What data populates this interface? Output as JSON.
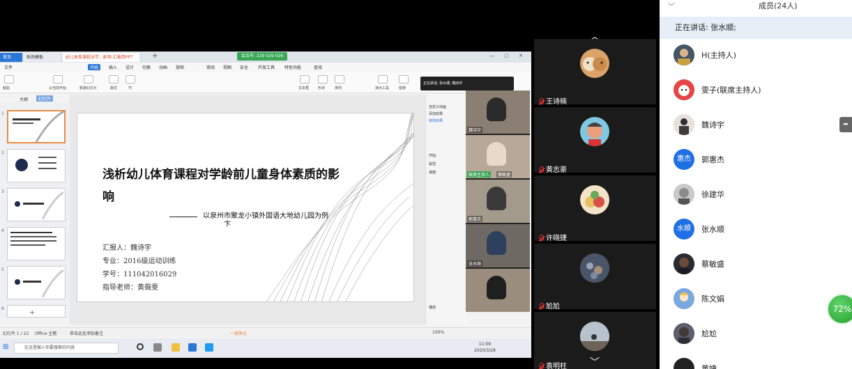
{
  "wps": {
    "tabs": [
      "首页",
      "稻壳模板",
      "幼儿体育课程对学...影响-汇报用PPT"
    ],
    "share_badge": "会议号: 229 529 026",
    "menu": [
      "文件",
      "开始",
      "插入",
      "设计",
      "切换",
      "动画",
      "放映",
      "审阅",
      "视图",
      "安全",
      "开发工具",
      "特色功能",
      "查找"
    ],
    "active_menu": "开始",
    "ribbon_labels": [
      "粘贴",
      "从当前开始",
      "新建幻灯片",
      "版式",
      "节",
      "文本框",
      "形状",
      "排列",
      "演示工具",
      "替换"
    ],
    "panel_tabs": [
      "大纲",
      "幻灯片"
    ],
    "thumb_numbers": [
      "1",
      "2",
      "3",
      "4",
      "5",
      "6"
    ],
    "slide": {
      "title": "浅析幼儿体育课程对学龄前儿童身体素质的影响",
      "dash": "———",
      "subtitle": "以泉州市聚龙小镇外国语大地幼儿园为例",
      "subtitle_tail": "卞",
      "reporter": "汇报人：魏诗宇",
      "major": "专业：2016级运动训练",
      "student_id": "学号：111042016029",
      "advisor": "指导老师：黄薇雯"
    },
    "side_pane": [
      "自定义动画",
      "添加效果",
      "修改效果",
      "开始:",
      "属性:",
      "速度:",
      "播放"
    ],
    "tooltip": "正在讲话: 张水顺; 魏诗宇",
    "video_tiles": [
      {
        "name": "魏诗宇",
        "tag": ""
      },
      {
        "name": "蔡敏盛",
        "tag": "联席主持人"
      },
      {
        "name": "郭惠杰",
        "tag": ""
      },
      {
        "name": "张水顺",
        "tag": ""
      },
      {
        "name": "",
        "tag": ""
      }
    ],
    "status": {
      "slide_count": "幻灯片 1 / 22",
      "theme": "Office 主题",
      "notes": "单击此处添加备注",
      "beautify": "一键美化",
      "zoom": "100%"
    },
    "taskbar": {
      "search_placeholder": "在这里输入你要搜索的内容",
      "time": "11:09",
      "date": "2020/3/28"
    }
  },
  "gallery": {
    "participants": [
      "王诗楠",
      "黄志豪",
      "许晓捷",
      "尬尬",
      "袁明柱"
    ]
  },
  "members": {
    "title": "成员(24人)",
    "speaking": "正在讲话: 张水顺;",
    "list": [
      {
        "avatar": "",
        "name": "H(主持人)"
      },
      {
        "avatar": "",
        "name": "雯子(联席主持人)"
      },
      {
        "avatar": "",
        "name": "魏诗宇"
      },
      {
        "avatar": "惠杰",
        "name": "郭惠杰"
      },
      {
        "avatar": "",
        "name": "徐建华"
      },
      {
        "avatar": "水顺",
        "name": "张水顺"
      },
      {
        "avatar": "",
        "name": "蔡敏盛"
      },
      {
        "avatar": "",
        "name": "陈文娟"
      },
      {
        "avatar": "",
        "name": "尬尬"
      },
      {
        "avatar": "",
        "name": "黄婕"
      }
    ],
    "network_percent": "72%"
  }
}
